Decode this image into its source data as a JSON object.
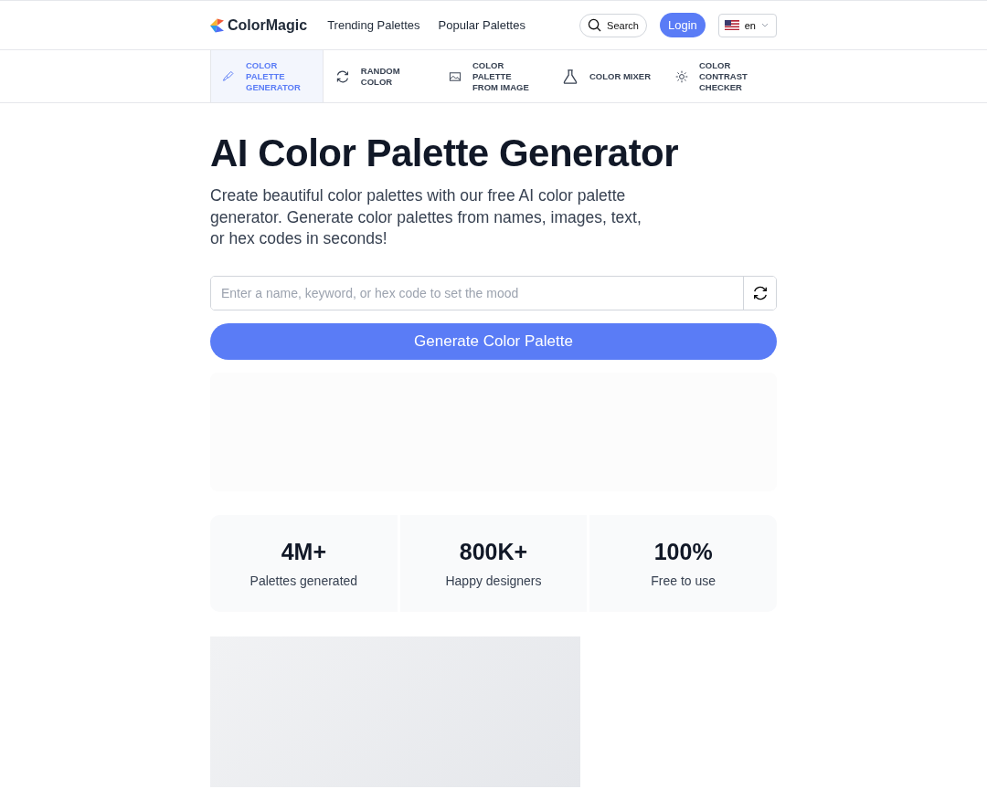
{
  "header": {
    "logo": "ColorMagic",
    "links": [
      "Trending Palettes",
      "Popular Palettes"
    ],
    "search": "Search",
    "login": "Login",
    "language": "en"
  },
  "tools": [
    {
      "label": "COLOR PALETTE GENERATOR",
      "selected": true
    },
    {
      "label": "RANDOM COLOR",
      "selected": false
    },
    {
      "label": "COLOR PALETTE FROM IMAGE",
      "selected": false
    },
    {
      "label": "COLOR MIXER",
      "selected": false
    },
    {
      "label": "COLOR CONTRAST CHECKER",
      "selected": false
    }
  ],
  "title": "AI Color Palette Generator",
  "intro": "Create beautiful color palettes with our free AI color palette generator. Generate color palettes from names, images, text, or hex codes in seconds!",
  "prompt": {
    "placeholder": "Enter a name, keyword, or hex code to set the mood"
  },
  "generate_button": "Generate Color Palette",
  "stats": [
    {
      "value": "4M+",
      "label": "Palettes generated"
    },
    {
      "value": "800K+",
      "label": "Happy designers"
    },
    {
      "value": "100%",
      "label": "Free to use"
    }
  ]
}
